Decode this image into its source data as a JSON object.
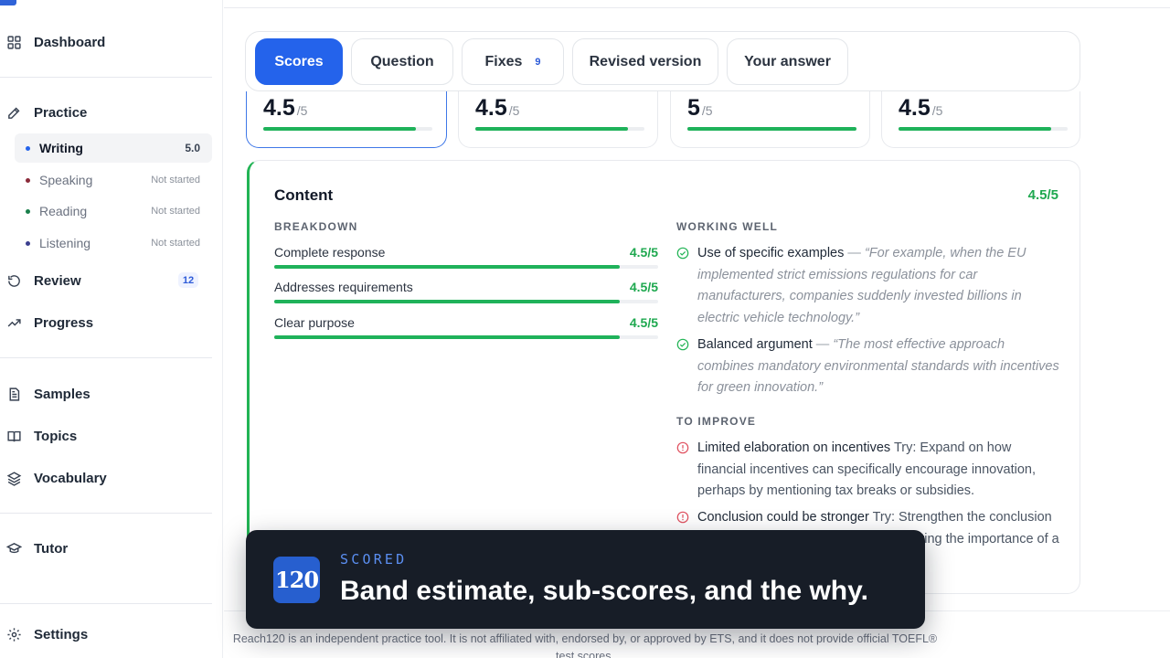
{
  "sidebar": {
    "dashboard": "Dashboard",
    "practice": "Practice",
    "practice_items": [
      {
        "label": "Writing",
        "status": "5.0",
        "dot": "#2463eb"
      },
      {
        "label": "Speaking",
        "status": "Not started",
        "dot": "#8b2a3a"
      },
      {
        "label": "Reading",
        "status": "Not started",
        "dot": "#1a7f4b"
      },
      {
        "label": "Listening",
        "status": "Not started",
        "dot": "#3b3f8f"
      }
    ],
    "review": "Review",
    "review_badge": "12",
    "progress": "Progress",
    "samples": "Samples",
    "topics": "Topics",
    "vocabulary": "Vocabulary",
    "tutor": "Tutor",
    "settings": "Settings"
  },
  "tabs": {
    "scores": "Scores",
    "question": "Question",
    "fixes": "Fixes",
    "fixes_count": "9",
    "revised": "Revised version",
    "answer": "Your answer"
  },
  "score_cards": [
    {
      "value": "4.5",
      "max": "/5",
      "fill": 0.9
    },
    {
      "value": "4.5",
      "max": "/5",
      "fill": 0.9
    },
    {
      "value": "5",
      "max": "/5",
      "fill": 1.0
    },
    {
      "value": "4.5",
      "max": "/5",
      "fill": 0.9
    }
  ],
  "content": {
    "title": "Content",
    "score": "4.5/5",
    "breakdown_label": "BREAKDOWN",
    "breakdown": [
      {
        "label": "Complete response",
        "score": "4.5/5",
        "fill": 0.9
      },
      {
        "label": "Addresses requirements",
        "score": "4.5/5",
        "fill": 0.9
      },
      {
        "label": "Clear purpose",
        "score": "4.5/5",
        "fill": 0.9
      }
    ],
    "working_well_label": "WORKING WELL",
    "working_well": [
      {
        "heading": "Use of specific examples",
        "quote": "“For example, when the EU implemented strict emissions regulations for car manufacturers, companies suddenly invested billions in electric vehicle technology.”"
      },
      {
        "heading": "Balanced argument",
        "quote": "“The most effective approach combines mandatory environmental standards with incentives for green innovation.”"
      }
    ],
    "to_improve_label": "TO IMPROVE",
    "to_improve": [
      {
        "heading": "Limited elaboration on incentives",
        "text": "Try: Expand on how financial incentives can specifically encourage innovation, perhaps by mentioning tax breaks or subsidies."
      },
      {
        "heading": "Conclusion could be stronger",
        "text": "Try: Strengthen the conclusion by summarizing key points and reiterating the importance of a combined approach."
      }
    ]
  },
  "footer": {
    "disclaimer": "Reach120 is an independent practice tool. It is not affiliated with, endorsed by, or approved by ETS, and it does not provide official TOEFL® test scores."
  },
  "overlay": {
    "logo": "120",
    "kicker": "SCORED",
    "title": "Band estimate, sub-scores, and the why."
  },
  "colors": {
    "accent": "#2463eb",
    "success": "#1fb25a",
    "warning": "#e0505f",
    "overlay_bg": "#171d27"
  }
}
